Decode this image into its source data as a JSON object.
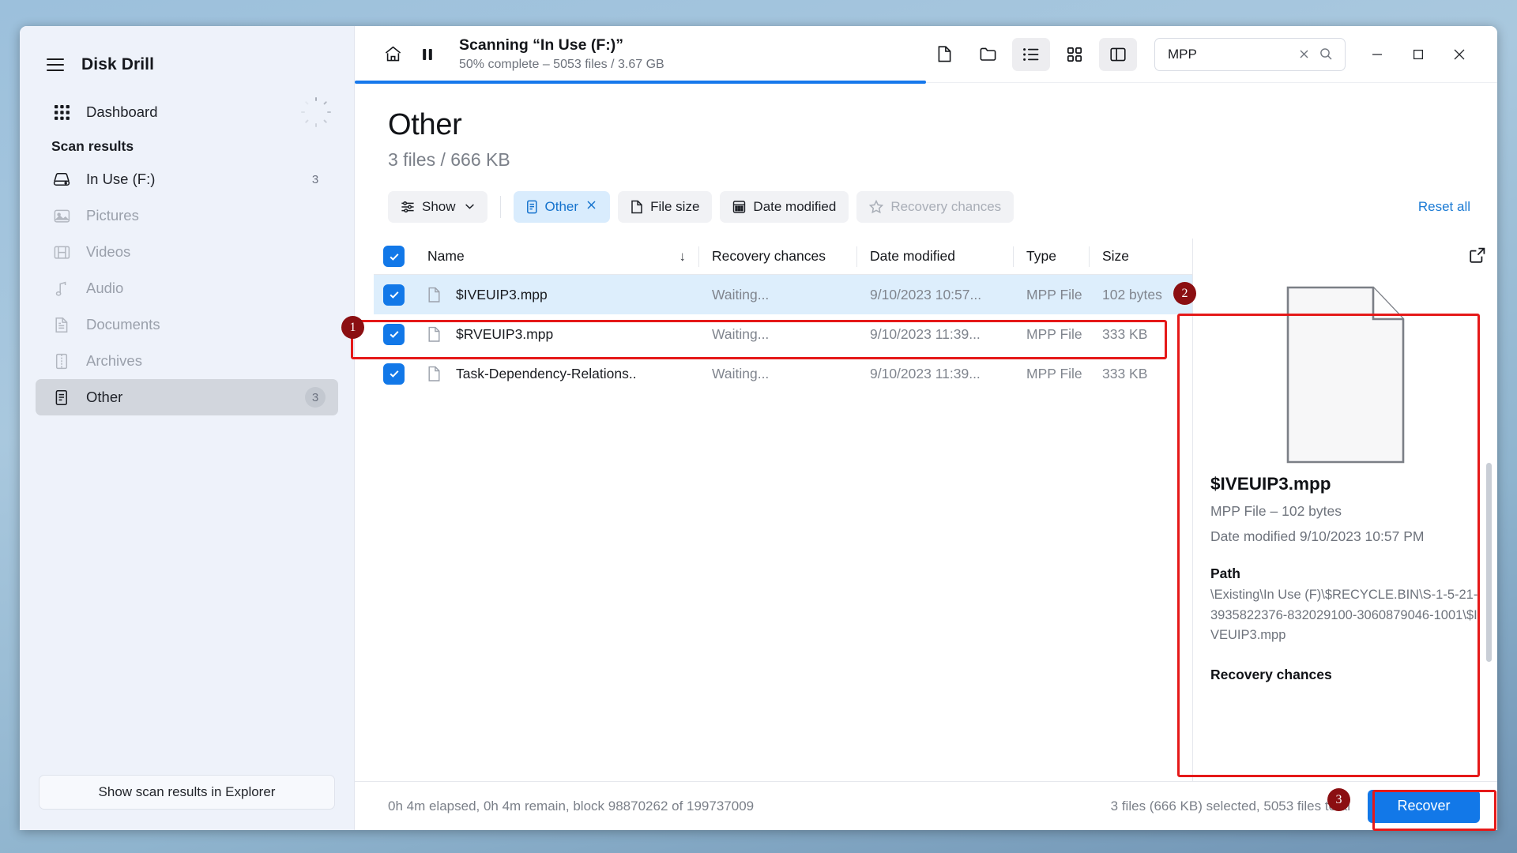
{
  "app": {
    "title": "Disk Drill",
    "menu_icon": "hamburger-icon"
  },
  "sidebar": {
    "dashboard": {
      "label": "Dashboard",
      "icon": "grid-icon"
    },
    "section_label": "Scan results",
    "items": [
      {
        "label": "In Use (F:)",
        "icon": "drive-icon",
        "count": "3",
        "state": "normal"
      },
      {
        "label": "Pictures",
        "icon": "image-icon",
        "count": "",
        "state": "dim"
      },
      {
        "label": "Videos",
        "icon": "film-icon",
        "count": "",
        "state": "dim"
      },
      {
        "label": "Audio",
        "icon": "music-note-icon",
        "count": "",
        "state": "dim"
      },
      {
        "label": "Documents",
        "icon": "document-icon",
        "count": "",
        "state": "dim"
      },
      {
        "label": "Archives",
        "icon": "archive-icon",
        "count": "",
        "state": "dim"
      },
      {
        "label": "Other",
        "icon": "other-file-icon",
        "count": "3",
        "state": "selected"
      }
    ],
    "footer_button": "Show scan results in Explorer"
  },
  "topbar": {
    "home_icon": "home-icon",
    "pause_icon": "pause-icon",
    "scan_title": "Scanning “In Use (F:)”",
    "scan_subtitle": "50% complete – 5053 files / 3.67 GB",
    "progress_percent": 50,
    "view_toggles": [
      {
        "icon": "file-view-icon",
        "active": false
      },
      {
        "icon": "folder-view-icon",
        "active": false
      },
      {
        "icon": "list-view-icon",
        "active": true
      },
      {
        "icon": "grid-view-icon",
        "active": false
      },
      {
        "icon": "preview-pane-icon",
        "active": true
      }
    ],
    "search": {
      "value": "MPP",
      "placeholder": "Search",
      "clear_icon": "close-icon",
      "search_icon": "search-icon"
    },
    "window_controls": {
      "minimize": "minimize-icon",
      "maximize": "maximize-icon",
      "close": "close-icon"
    }
  },
  "page": {
    "title": "Other",
    "subtitle": "3 files / 666 KB"
  },
  "filters": {
    "show_label": "Show",
    "chips": [
      {
        "label": "Other",
        "icon": "other-file-icon",
        "active": true,
        "removable": true
      },
      {
        "label": "File size",
        "icon": "document-icon",
        "active": false,
        "removable": false
      },
      {
        "label": "Date modified",
        "icon": "calendar-icon",
        "active": false,
        "removable": false
      },
      {
        "label": "Recovery chances",
        "icon": "star-icon",
        "active": false,
        "disabled": true,
        "removable": false
      }
    ],
    "reset_all": "Reset all"
  },
  "table": {
    "columns": [
      "Name",
      "Recovery chances",
      "Date modified",
      "Type",
      "Size"
    ],
    "sort_indicator": "↓",
    "header_checkbox_checked": true,
    "rows": [
      {
        "checked": true,
        "name": "$IVEUIP3.mpp",
        "recovery": "Waiting...",
        "date": "9/10/2023 10:57...",
        "type": "MPP File",
        "size": "102 bytes",
        "selected": true
      },
      {
        "checked": true,
        "name": "$RVEUIP3.mpp",
        "recovery": "Waiting...",
        "date": "9/10/2023 11:39...",
        "type": "MPP File",
        "size": "333 KB",
        "selected": false
      },
      {
        "checked": true,
        "name": "Task-Dependency-Relations..",
        "recovery": "Waiting...",
        "date": "9/10/2023 11:39...",
        "type": "MPP File",
        "size": "333 KB",
        "selected": false
      }
    ]
  },
  "preview": {
    "open_external_icon": "external-link-icon",
    "thumbnail_icon": "document-page-icon",
    "file_name": "$IVEUIP3.mpp",
    "meta": "MPP File – 102 bytes",
    "date_modified": "Date modified 9/10/2023 10:57 PM",
    "path_heading": "Path",
    "path_value": "\\Existing\\In Use (F)\\$RECYCLE.BIN\\S-1-5-21-3935822376-832029100-3060879046-1001\\$IVEUIP3.mpp",
    "recovery_heading": "Recovery chances"
  },
  "statusbar": {
    "left": "0h 4m elapsed, 0h 4m remain, block 98870262 of 199737009",
    "right": "3 files (666 KB) selected, 5053 files total",
    "recover_button": "Recover"
  },
  "callouts": [
    {
      "number": "1"
    },
    {
      "number": "2"
    },
    {
      "number": "3"
    }
  ],
  "colors": {
    "accent": "#1278e8",
    "callout_red": "#e51919",
    "badge_red": "#8b0f12",
    "chip_active_bg": "#d9ecfd",
    "row_selected_bg": "#ddeefc"
  }
}
